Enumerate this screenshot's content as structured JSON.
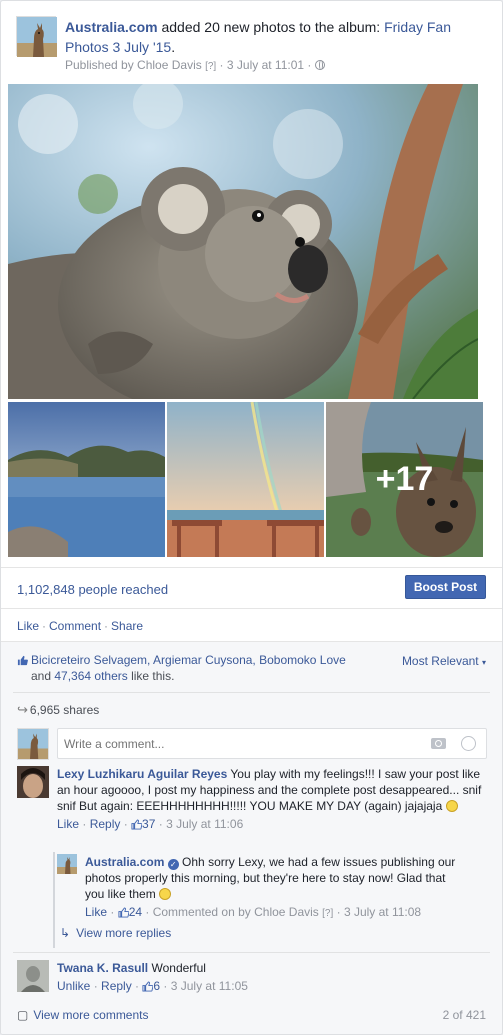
{
  "post": {
    "page_name": "Australia.com",
    "action_text": " added 20 new photos to the album: ",
    "album_name": "Friday Fan Photos 3 July '15",
    "period": ".",
    "published_by_prefix": "Published by ",
    "published_by": "Chloe Davis",
    "help_marker": "[?]",
    "timestamp": "3 July at 11:01",
    "more_photos_label": "+17"
  },
  "reach": {
    "count": "1,102,848",
    "suffix": " people reached",
    "boost_label": "Boost Post"
  },
  "actions": {
    "like": "Like",
    "comment": "Comment",
    "share": "Share"
  },
  "likes": {
    "names": "Bicicreteiro Selvagem, Argiemar Cuysona, Bobomoko Love",
    "and": " and ",
    "others": "47,364 others",
    "suffix": " like this.",
    "sort_label": "Most Relevant"
  },
  "shares": {
    "label": "6,965 shares"
  },
  "composer": {
    "placeholder": "Write a comment..."
  },
  "comments": [
    {
      "author": "Lexy Luzhikaru Aguilar Reyes",
      "text": "You play with my feelings!!! I saw your post like an hour agoooo, I post my happiness and the complete post desappeared... snif snif But again: EEEHHHHHHHH!!!!! YOU MAKE MY DAY (again) jajajaja",
      "like_label": "Like",
      "reply_label": "Reply",
      "like_count": "37",
      "time": "3 July at 11:06"
    },
    {
      "author": "Australia.com",
      "text": "Ohh sorry Lexy, we had a few issues publishing our photos properly this morning, but they're here to stay now! Glad that you like them",
      "like_label": "Like",
      "like_count": "24",
      "commented_by": "Commented on by Chloe Davis",
      "help_marker": "[?]",
      "time": "3 July at 11:08"
    },
    {
      "author": "Twana K. Rasull",
      "text": "Wonderful",
      "unlike_label": "Unlike",
      "reply_label": "Reply",
      "like_count": "6",
      "time": "3 July at 11:05"
    }
  ],
  "view_more_replies": "View more replies",
  "view_more_comments": "View more comments",
  "pagination": "2 of 421",
  "colors": {
    "link": "#3b5998",
    "boost_button": "#4267b2",
    "muted": "#90949c"
  }
}
